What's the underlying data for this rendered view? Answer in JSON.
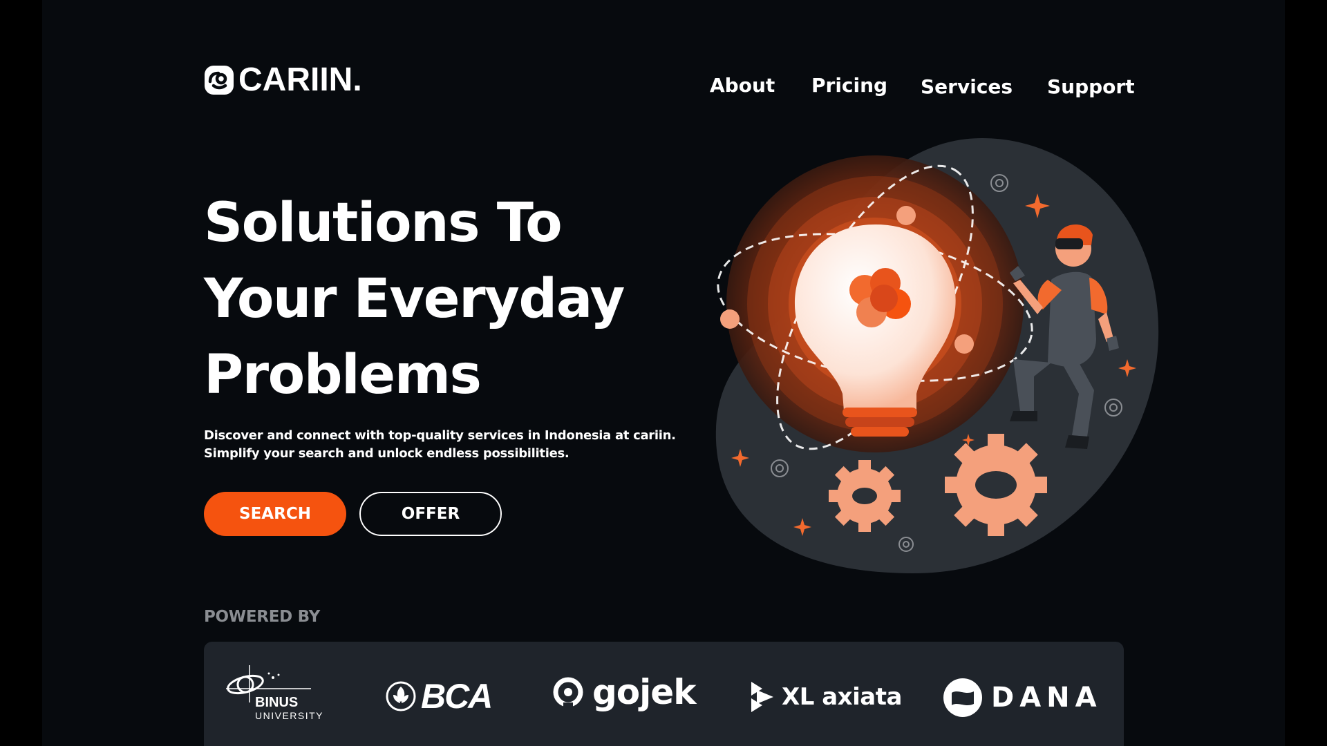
{
  "brand": {
    "name": "CARIIN.",
    "logo_icon": "cariin-logo-icon"
  },
  "nav": {
    "items": [
      {
        "label": "About"
      },
      {
        "label": "Pricing"
      },
      {
        "label": "Services"
      },
      {
        "label": "Support"
      }
    ]
  },
  "hero": {
    "title_lines": [
      "Solutions To",
      "Your Everyday",
      "Problems"
    ],
    "subtitle_lines": [
      "Discover and connect with top-quality services in Indonesia at cariin.",
      "Simplify your search and unlock endless possibilities."
    ],
    "search_button": "SEARCH",
    "offer_button": "OFFER",
    "illustration": "lightbulb-atom-vr-person-gears-illustration"
  },
  "powered_by": {
    "label": "POWERED BY",
    "partners": {
      "binus": {
        "name": "BINUS",
        "sub": "UNIVERSITY",
        "icon": "binus-logo"
      },
      "bca": {
        "name": "BCA",
        "icon": "bca-logo"
      },
      "gojek": {
        "name": "gojek",
        "icon": "gojek-logo"
      },
      "xl": {
        "name": "XL axiata",
        "icon": "xl-axiata-logo"
      },
      "dana": {
        "name": "DANA",
        "icon": "dana-logo"
      }
    }
  },
  "colors": {
    "background": "#070a0e",
    "accent": "#f5530f",
    "text": "#ffffff",
    "muted": "#8a8d92",
    "panel": "#1f242b"
  }
}
